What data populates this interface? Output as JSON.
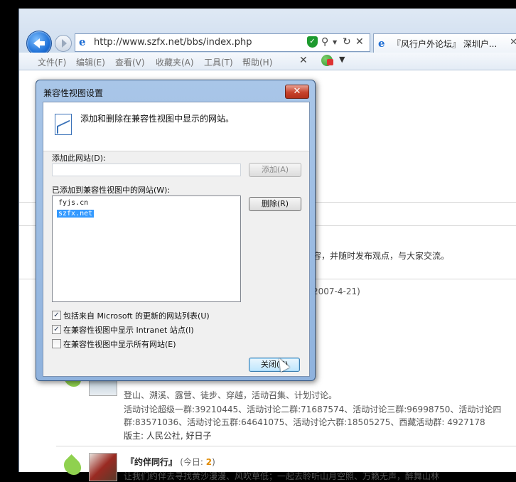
{
  "browser": {
    "address": "http://www.szfx.net/bbs/index.php",
    "tab_title": "『风行户外论坛』 深圳户...",
    "tab_close": "✕",
    "menu": [
      "文件(F)",
      "编辑(E)",
      "查看(V)",
      "收藏夹(A)",
      "工具(T)",
      "帮助(H)"
    ],
    "menu_close": "✕",
    "menu_dropdown": "▼"
  },
  "page": {
    "intro_fragment": "容，并随时发布观点，与大家交流。",
    "date_fragment": "2007-4-21)",
    "forum1": {
      "desc": "登山、溯溪、露营、徒步、穿越，活动召集、计划讨论。",
      "groups_line1": "活动讨论超级一群:39210445、活动讨论二群:71687574、活动讨论三群:96998750、活动讨论四",
      "groups_line2": "群:83571036、活动讨论五群:64641075、活动讨论六群:18505275、西藏活动群: 4927178",
      "moderator": "版主: 人民公社, 好日子"
    },
    "forum2": {
      "title": "『约伴同行』",
      "today_label": "(今日: ",
      "today_count": "2",
      "today_end": ")",
      "desc": "让我们约伴去寻找黄沙漫漫、风吹草低；一起去聆听山月空照、万籁无声，醉舞山林"
    }
  },
  "dialog": {
    "title": "兼容性视图设置",
    "close_glyph": "✕",
    "description": "添加和删除在兼容性视图中显示的网站。",
    "add_label": "添加此网站(D):",
    "add_value": "",
    "add_button": "添加(A)",
    "list_label": "已添加到兼容性视图中的网站(W):",
    "sites": [
      "fyjs.cn",
      "szfx.net"
    ],
    "selected_site": "szfx.net",
    "remove_button": "删除(R)",
    "checkboxes": [
      {
        "label": "包括来自 Microsoft 的更新的网站列表(U)",
        "checked": true
      },
      {
        "label": "在兼容性视图中显示 Intranet 站点(I)",
        "checked": true
      },
      {
        "label": "在兼容性视图中显示所有网站(E)",
        "checked": false
      }
    ],
    "close_button": "关闭(C)"
  },
  "icons": {
    "check": "✓",
    "page_icon": "e",
    "secure": "✓"
  }
}
